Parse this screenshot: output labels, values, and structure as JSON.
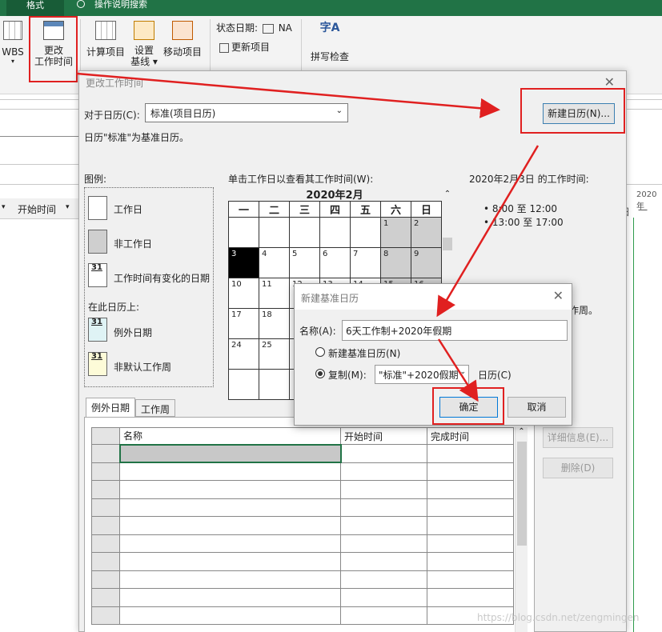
{
  "ribbon": {
    "tab_format": "格式",
    "tell_me": "操作说明搜索",
    "wbs_label": "WBS",
    "change_working_time": [
      "更改",
      "工作时间"
    ],
    "calculate_project": "计算项目",
    "set_baseline": [
      "设置",
      "基线"
    ],
    "move_project": "移动项目",
    "status_date_label": "状态日期:",
    "status_date_value": "NA",
    "update_project": "更新项目",
    "spelling": "拼写检查",
    "spelling_icon_text": "字A"
  },
  "sheet": {
    "start_time_col": "开始时间",
    "right_header_year": "2020年",
    "right_header_day": "日",
    "right_header_mon": "一"
  },
  "main_dialog": {
    "title": "更改工作时间",
    "for_calendar_label": "对于日历(C):",
    "calendar_value": "标准(项目日历)",
    "base_note": "日历\"标准\"为基准日历。",
    "new_calendar_button": "新建日历(N)...",
    "legend_title": "图例:",
    "legend_workday": "工作日",
    "legend_nonworkday": "非工作日",
    "legend_changed": "工作时间有变化的日期",
    "legend_changed_num": "31",
    "on_this_calendar": "在此日历上:",
    "legend_exception": "例外日期",
    "legend_nondefault": "非默认工作周",
    "click_hint": "单击工作日以查看其工作时间(W):",
    "month_title": "2020年2月",
    "weekdays": [
      "一",
      "二",
      "三",
      "四",
      "五",
      "六",
      "日"
    ],
    "weeks": [
      [
        "",
        "",
        "",
        "",
        "",
        "1",
        "2"
      ],
      [
        "3",
        "4",
        "5",
        "6",
        "7",
        "8",
        "9"
      ],
      [
        "10",
        "11",
        "12",
        "13",
        "14",
        "15",
        "16"
      ],
      [
        "17",
        "18",
        "",
        "",
        "",
        "",
        ""
      ],
      [
        "24",
        "25",
        "",
        "",
        "",
        "",
        ""
      ],
      [
        "",
        "",
        "",
        "",
        "",
        "",
        ""
      ]
    ],
    "working_times_title": "2020年2月3日 的工作时间:",
    "time_1": "• 8:00 至 12:00",
    "time_2": "• 13:00 至 17:00",
    "partial_note": "作周。",
    "tab_exceptions": "例外日期",
    "tab_workweek": "工作周",
    "col_name": "名称",
    "col_start": "开始时间",
    "col_finish": "完成时间",
    "details_button": "详细信息(E)...",
    "delete_button": "删除(D)"
  },
  "sub_dialog": {
    "title": "新建基准日历",
    "name_label": "名称(A):",
    "name_value": "6天工作制+2020年假期",
    "option_new": "新建基准日历(N)",
    "option_copy": "复制(M):",
    "copy_value": "\"标准\"+2020假期",
    "calendar_suffix": "日历(C)",
    "ok_button": "确定",
    "cancel_button": "取消"
  },
  "watermark": "https://blog.csdn.net/zengmingen",
  "colors": {
    "accent_green": "#217346",
    "highlight_red": "#e02020",
    "selected_blue": "#0078d7"
  }
}
